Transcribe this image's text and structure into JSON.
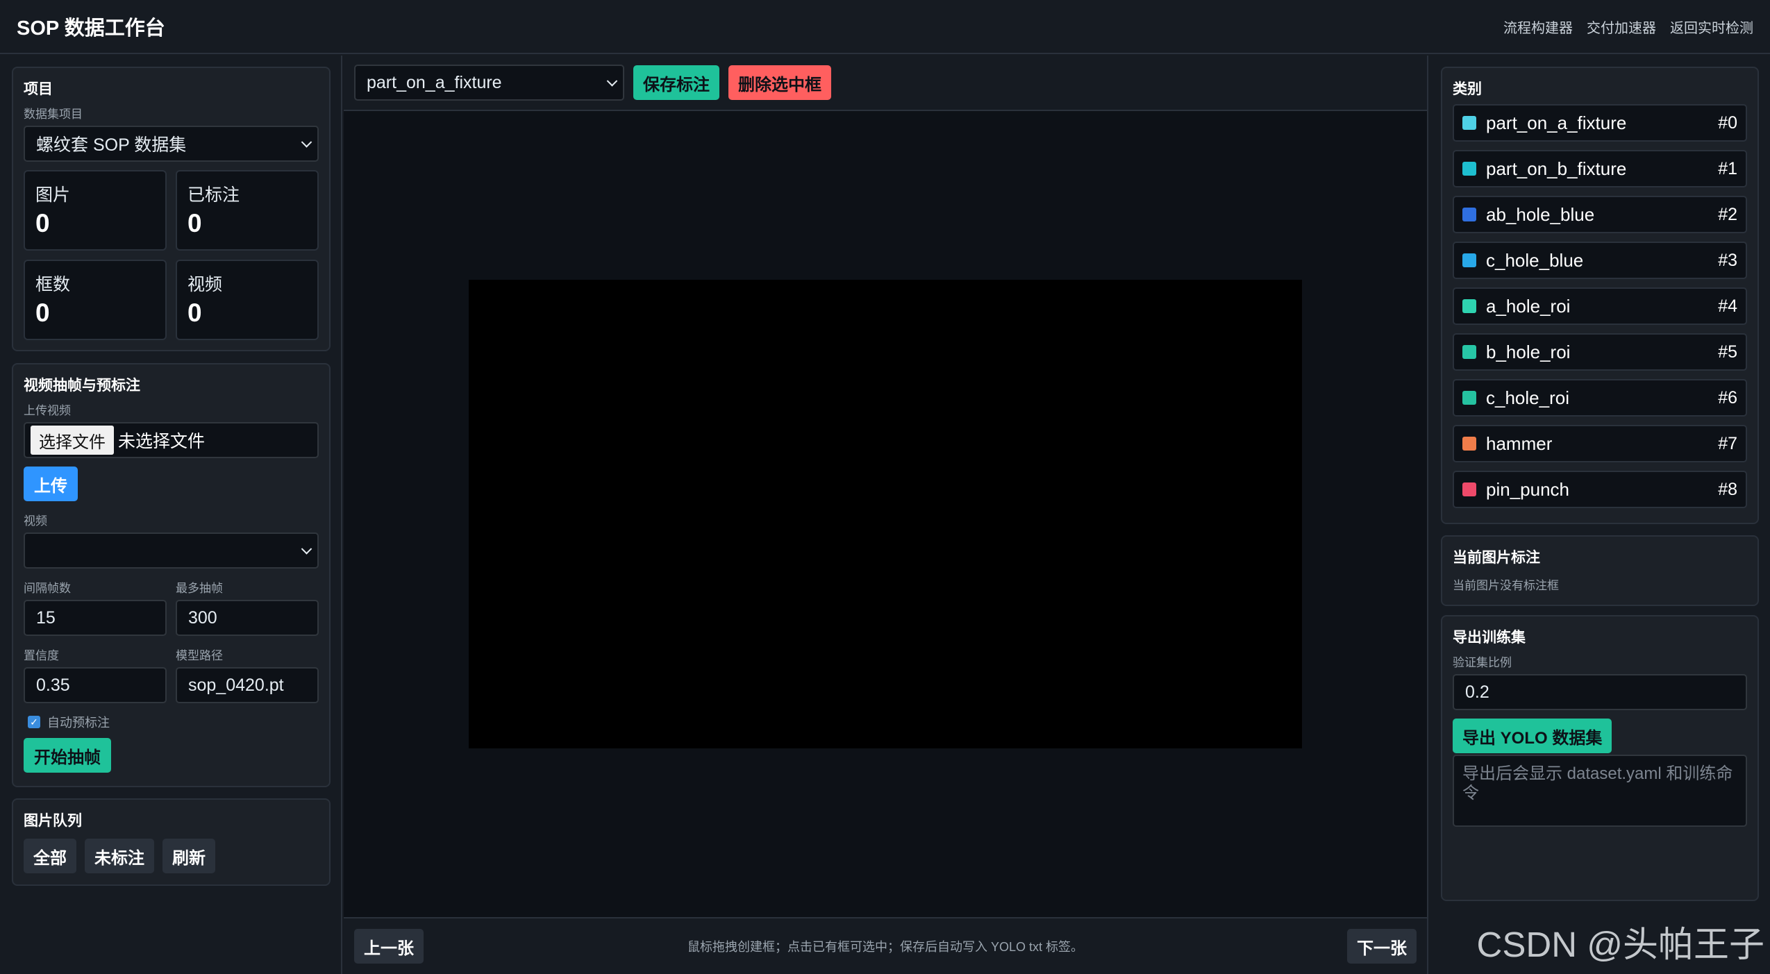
{
  "app": {
    "title": "SOP 数据工作台",
    "links": [
      "流程构建器",
      "交付加速器",
      "返回实时检测"
    ]
  },
  "project_panel": {
    "title": "项目",
    "dataset_label": "数据集项目",
    "dataset_value": "螺纹套 SOP 数据集",
    "stats": [
      {
        "label": "图片",
        "value": "0"
      },
      {
        "label": "已标注",
        "value": "0"
      },
      {
        "label": "框数",
        "value": "0"
      },
      {
        "label": "视频",
        "value": "0"
      }
    ]
  },
  "video_panel": {
    "title": "视频抽帧与预标注",
    "upload_label": "上传视频",
    "file_button": "选择文件",
    "file_status": "未选择文件",
    "upload_button": "上传",
    "video_label": "视频",
    "video_value": "",
    "interval_label": "间隔帧数",
    "interval_value": "15",
    "max_frames_label": "最多抽帧",
    "max_frames_value": "300",
    "confidence_label": "置信度",
    "confidence_value": "0.35",
    "model_label": "模型路径",
    "model_value": "sop_0420.pt",
    "auto_label": "自动预标注",
    "auto_checked": true,
    "start_button": "开始抽帧"
  },
  "queue_panel": {
    "title": "图片队列",
    "buttons": [
      "全部",
      "未标注",
      "刷新"
    ]
  },
  "canvas": {
    "class_select": "part_on_a_fixture",
    "save_button": "保存标注",
    "delete_button": "删除选中框",
    "prev_button": "上一张",
    "next_button": "下一张",
    "hint": "鼠标拖拽创建框；点击已有框可选中；保存后自动写入 YOLO txt 标签。"
  },
  "categories_panel": {
    "title": "类别",
    "items": [
      {
        "name": "part_on_a_fixture",
        "index": "#0",
        "color": "#4fd1e6"
      },
      {
        "name": "part_on_b_fixture",
        "index": "#1",
        "color": "#1ebfd0"
      },
      {
        "name": "ab_hole_blue",
        "index": "#2",
        "color": "#2f6fe0"
      },
      {
        "name": "c_hole_blue",
        "index": "#3",
        "color": "#28a8e8"
      },
      {
        "name": "a_hole_roi",
        "index": "#4",
        "color": "#2ed3b0"
      },
      {
        "name": "b_hole_roi",
        "index": "#5",
        "color": "#27c6a6"
      },
      {
        "name": "c_hole_roi",
        "index": "#6",
        "color": "#25c2a0"
      },
      {
        "name": "hammer",
        "index": "#7",
        "color": "#f07d4a"
      },
      {
        "name": "pin_punch",
        "index": "#8",
        "color": "#ee4a6a"
      }
    ]
  },
  "current_panel": {
    "title": "当前图片标注",
    "empty_text": "当前图片没有标注框"
  },
  "export_panel": {
    "title": "导出训练集",
    "ratio_label": "验证集比例",
    "ratio_value": "0.2",
    "export_button": "导出 YOLO 数据集",
    "output_placeholder": "导出后会显示 dataset.yaml 和训练命令"
  },
  "watermark": "CSDN @头帕王子"
}
